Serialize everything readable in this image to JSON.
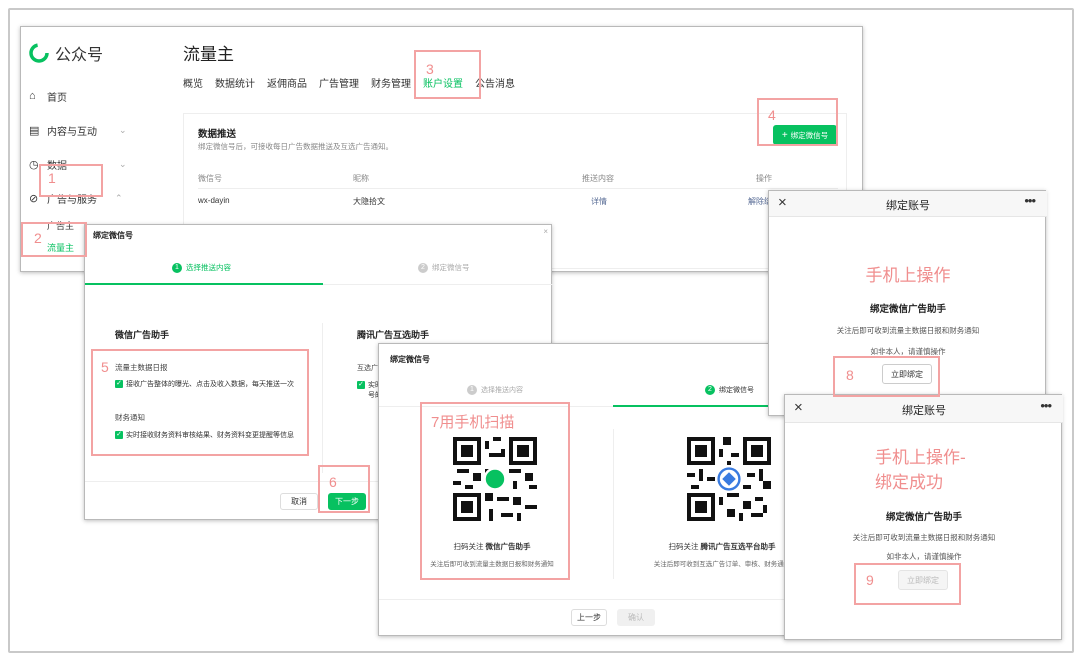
{
  "main": {
    "logo_text": "公众号",
    "page_title": "流量主",
    "sidebar": [
      {
        "icon": "home-icon",
        "glyph": "⌂",
        "label": "首页"
      },
      {
        "icon": "document-icon",
        "glyph": "▤",
        "label": "内容与互动"
      },
      {
        "icon": "clock-icon",
        "glyph": "◷",
        "label": "数据"
      },
      {
        "icon": "compass-icon",
        "glyph": "⊘",
        "label": "广告与服务"
      }
    ],
    "sub_items": [
      "广告主",
      "流量主"
    ],
    "tabs": [
      "概览",
      "数据统计",
      "返佣商品",
      "广告管理",
      "财务管理",
      "账户设置",
      "公告消息"
    ],
    "section_title": "数据推送",
    "section_desc": "绑定微信号后，可接收每日广告数据推送及互选广告通知。",
    "bind_button": "绑定微信号",
    "table": {
      "headers": [
        "微信号",
        "昵称",
        "推送内容",
        "操作"
      ],
      "row": [
        "wx-dayin",
        "大隐拾文",
        "详情",
        "解除绑定"
      ]
    }
  },
  "dialog1": {
    "title": "绑定微信号",
    "step1": "选择推送内容",
    "step2": "绑定微信号",
    "col1_title": "微信广告助手",
    "opt1_title": "流量主数据日报",
    "opt1_desc": "接收广告整体的曝光、点击及收入数据，每天推送一次",
    "opt2_title": "财务通知",
    "opt2_desc": "实时接收财务资料审核结果、财务资料变更提醒等信息",
    "col2_title": "腾讯广告互选助手",
    "col2_sub": "互选广告",
    "col2_item": "实时",
    "col2_item2": "号的",
    "cancel": "取消",
    "next": "下一步"
  },
  "dialog2": {
    "title": "绑定微信号",
    "step1": "选择推送内容",
    "step2": "绑定微信号",
    "qr1_prefix": "扫码关注",
    "qr1_name": "微信广告助手",
    "qr1_desc": "关注后即可收到流量主数据日报和财务通知",
    "qr2_prefix": "扫码关注",
    "qr2_name": "腾讯广告互选平台助手",
    "qr2_desc": "关注后即可收到互选广告订单、审核、财务通知",
    "prev": "上一步",
    "confirm": "确认"
  },
  "phone1": {
    "title": "绑定账号",
    "heading": "手机上操作",
    "name": "绑定微信广告助手",
    "desc": "关注后即可收到流量主数据日报和财务通知",
    "warn": "如非本人，请谨慎操作",
    "button": "立即绑定"
  },
  "phone2": {
    "title": "绑定账号",
    "heading1": "手机上操作-",
    "heading2": "绑定成功",
    "name": "绑定微信广告助手",
    "desc": "关注后即可收到流量主数据日报和财务通知",
    "warn": "如非本人，请谨慎操作",
    "button": "立即绑定"
  },
  "annotations": {
    "n1": "1",
    "n2": "2",
    "n3": "3",
    "n4": "4",
    "n5": "5",
    "n6": "6",
    "n7": "7用手机扫描",
    "n8": "8",
    "n9": "9"
  },
  "colors": {
    "accent": "#07c160",
    "annotation": "#f3a3a3"
  }
}
